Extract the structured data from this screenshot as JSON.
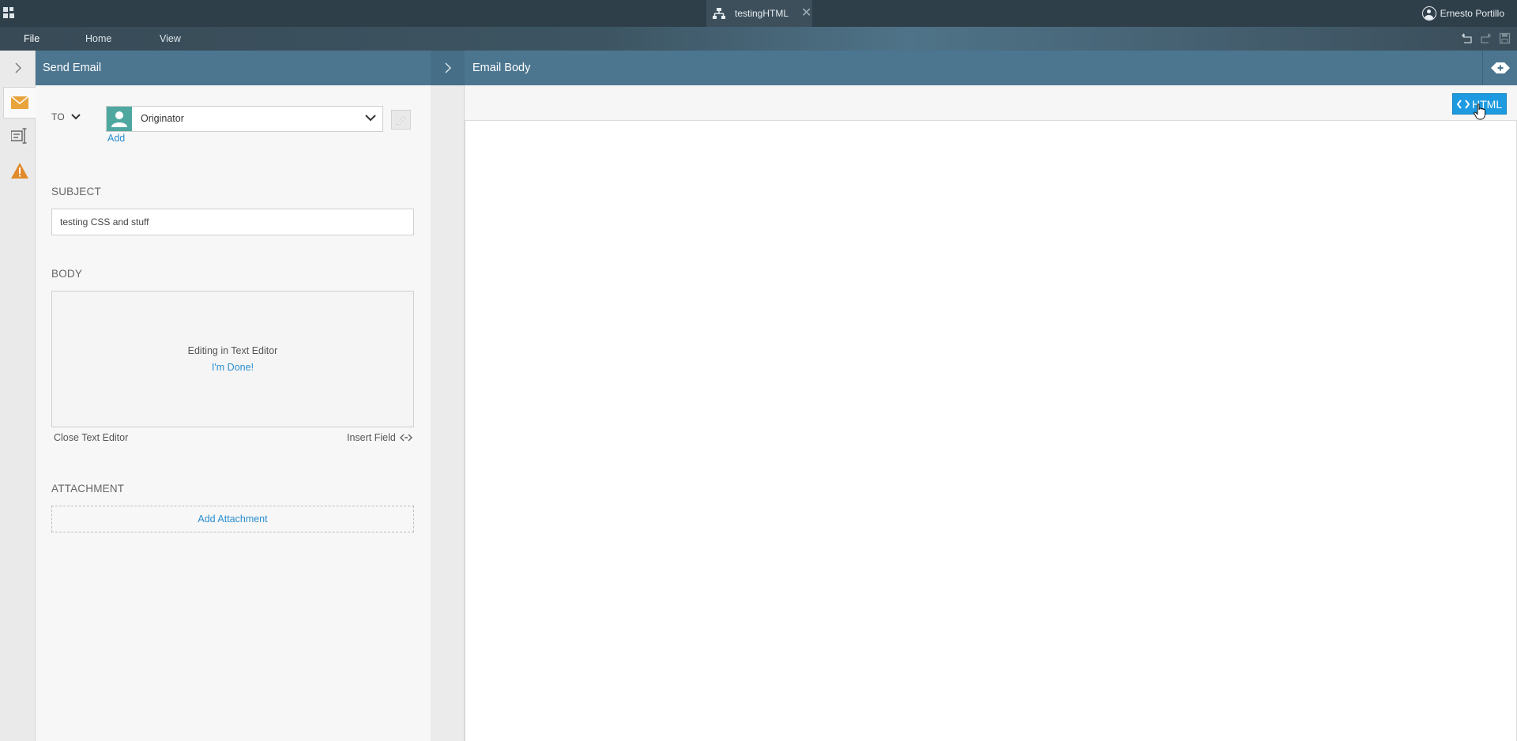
{
  "topbar": {
    "tab_title": "testingHTML",
    "user_name": "Ernesto Portillo"
  },
  "menu": {
    "items": [
      "File",
      "Home",
      "View"
    ]
  },
  "panel": {
    "title": "Send Email",
    "to_label": "TO",
    "recipient_value": "Originator",
    "add_label": "Add",
    "subject_label": "SUBJECT",
    "subject_value": "testing CSS and stuff",
    "body_label": "BODY",
    "body_status": "Editing in Text Editor",
    "body_done": "I'm Done!",
    "close_editor": "Close Text Editor",
    "insert_field": "Insert Field",
    "attachment_label": "ATTACHMENT",
    "add_attachment": "Add Attachment"
  },
  "main": {
    "title": "Email Body",
    "html_button": "HTML"
  },
  "colors": {
    "topbar": "#2f3f4a",
    "header": "#4c7690",
    "accent": "#1d9ae0",
    "link": "#2a8fd0",
    "rail_email_icon": "#e8a33b",
    "rail_warning_icon": "#e08a2c",
    "user_tile": "#4fa8a0"
  },
  "icons": {
    "app": "app-grid-icon",
    "tab": "workflow-icon",
    "close": "close-icon",
    "user": "user-circle-icon",
    "undo": "undo-icon",
    "redo": "redo-icon",
    "save": "save-icon",
    "rail_toggle": "chevron-right-icon",
    "rail_email": "email-icon",
    "rail_form": "form-field-icon",
    "rail_warning": "warning-icon",
    "recipient_user": "user-icon",
    "dropdown": "chevron-down-icon",
    "edit": "pencil-icon",
    "insert_field": "insert-field-icon",
    "expand": "expand-icon",
    "html_code": "code-icon",
    "cursor": "hand-pointer-icon"
  }
}
